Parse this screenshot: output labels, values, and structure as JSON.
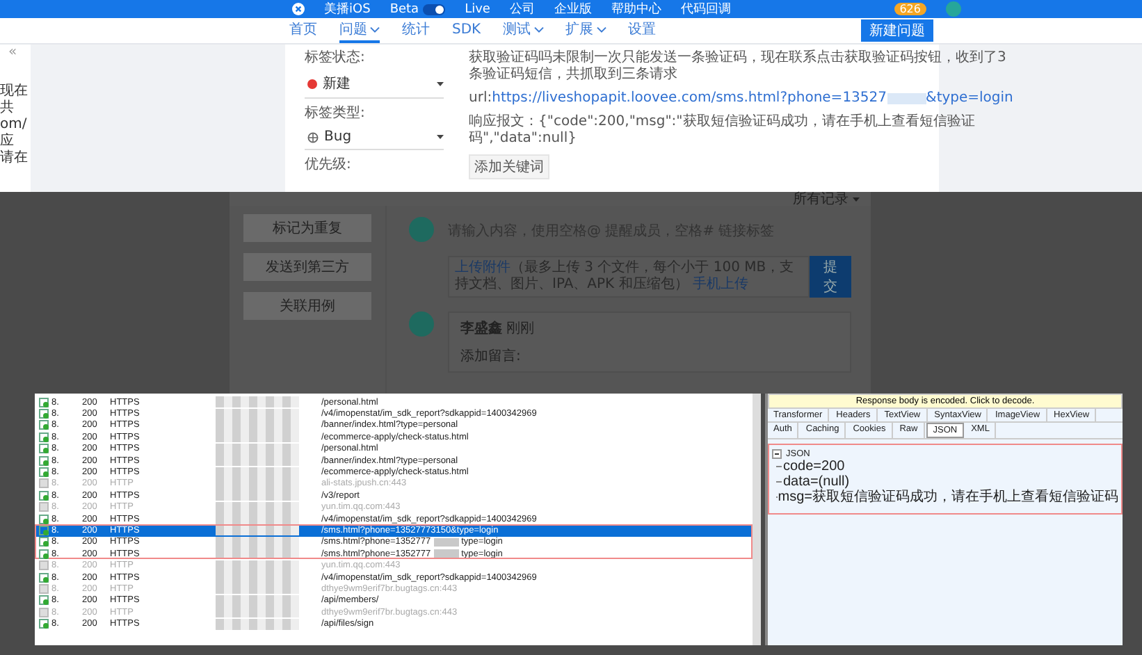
{
  "top_bar": {
    "items": [
      {
        "kind": "project",
        "label": "美播iOS"
      },
      {
        "kind": "toggle",
        "label": "Beta",
        "on": true
      },
      {
        "kind": "text",
        "label": "Live"
      },
      {
        "kind": "text",
        "label": "公司"
      },
      {
        "kind": "text",
        "label": "企业版"
      },
      {
        "kind": "text",
        "label": "帮助中心"
      },
      {
        "kind": "text",
        "label": "代码回调"
      }
    ],
    "badge": "626"
  },
  "nav": {
    "items": [
      {
        "label": "首页",
        "selected": false,
        "dropdown": false
      },
      {
        "label": "问题",
        "selected": true,
        "dropdown": true
      },
      {
        "label": "统计",
        "selected": false,
        "dropdown": false
      },
      {
        "label": "SDK",
        "selected": false,
        "dropdown": false
      },
      {
        "label": "测试",
        "selected": false,
        "dropdown": true
      },
      {
        "label": "扩展",
        "selected": false,
        "dropdown": true
      },
      {
        "label": "设置",
        "selected": false,
        "dropdown": false
      }
    ],
    "new_button": "新建问题"
  },
  "side_strip": {
    "collapse": "«",
    "fragments": [
      "现在",
      "共",
      "om/",
      "应",
      "请在"
    ]
  },
  "issue": {
    "fields": [
      {
        "label": "标签状态:",
        "value": "新建",
        "kind": "status",
        "color": "#e53935"
      },
      {
        "label": "标签类型:",
        "value": "Bug",
        "kind": "type"
      },
      {
        "label": "优先级:",
        "kind": "label"
      }
    ],
    "description": "获取验证码吗未限制一次只能发送一条验证码，现在联系点击获取验证码按钮，收到了3条验证码短信，共抓取到三条请求",
    "url_label": "url:",
    "url": "https://liveshopapit.loovee.com/sms.html?phone=13527",
    "url_end": "&type=login",
    "response": "响应报文：{\"code\":200,\"msg\":\"获取短信验证码成功，请在手机上查看短信验证码\",\"data\":null}",
    "keyword_button": "添加关键词"
  },
  "actions": [
    "标记为重复",
    "发送到第三方",
    "关联用例"
  ],
  "records_filter": "所有记录",
  "comment": {
    "placeholder": "请输入内容，使用空格@ 提醒成员，空格# 链接标签",
    "upload_link": "上传附件",
    "upload_note": "（最多上传 3 个文件，每个小于 100 MB，支持文档、图片、IPA、APK 和压缩包）",
    "mobile_link": "手机上传",
    "submit": "提交"
  },
  "entry": {
    "author": "李盛鑫",
    "time": "刚刚",
    "note": "添加留言:"
  },
  "sessions": [
    {
      "kind": "https",
      "result": "8.",
      "code": "200",
      "protocol": "HTTPS",
      "url": "/personal.html",
      "selected": false
    },
    {
      "kind": "https",
      "result": "8.",
      "code": "200",
      "protocol": "HTTPS",
      "url": "/v4/imopenstat/im_sdk_report?sdkappid=1400342969",
      "selected": false
    },
    {
      "kind": "https",
      "result": "8.",
      "code": "200",
      "protocol": "HTTPS",
      "url": "/banner/index.html?type=personal",
      "selected": false
    },
    {
      "kind": "https",
      "result": "8.",
      "code": "200",
      "protocol": "HTTPS",
      "url": "/ecommerce-apply/check-status.html",
      "selected": false
    },
    {
      "kind": "https",
      "result": "8.",
      "code": "200",
      "protocol": "HTTPS",
      "url": "/personal.html",
      "selected": false
    },
    {
      "kind": "https",
      "result": "8.",
      "code": "200",
      "protocol": "HTTPS",
      "url": "/banner/index.html?type=personal",
      "selected": false
    },
    {
      "kind": "https",
      "result": "8.",
      "code": "200",
      "protocol": "HTTPS",
      "url": "/ecommerce-apply/check-status.html",
      "selected": false
    },
    {
      "kind": "tunnel",
      "result": "8.",
      "code": "200",
      "protocol": "HTTP",
      "url": "ali-stats.jpush.cn:443",
      "selected": false
    },
    {
      "kind": "https",
      "result": "8.",
      "code": "200",
      "protocol": "HTTPS",
      "url": "/v3/report",
      "selected": false
    },
    {
      "kind": "tunnel",
      "result": "8.",
      "code": "200",
      "protocol": "HTTP",
      "url": "yun.tim.qq.com:443",
      "selected": false
    },
    {
      "kind": "https",
      "result": "8.",
      "code": "200",
      "protocol": "HTTPS",
      "url": "/v4/imopenstat/im_sdk_report?sdkappid=1400342969",
      "selected": false
    },
    {
      "kind": "https",
      "result": "8.",
      "code": "200",
      "protocol": "HTTPS",
      "url": "/sms.html?phone=13527773150&type=login",
      "selected": true
    },
    {
      "kind": "https",
      "result": "8.",
      "code": "200",
      "protocol": "HTTPS",
      "url": "/sms.html?phone=1352777",
      "url_end": "type=login",
      "selected": false
    },
    {
      "kind": "https",
      "result": "8.",
      "code": "200",
      "protocol": "HTTPS",
      "url": "/sms.html?phone=1352777",
      "url_end": "type=login",
      "selected": false
    },
    {
      "kind": "tunnel",
      "result": "8.",
      "code": "200",
      "protocol": "HTTP",
      "url": "yun.tim.qq.com:443",
      "selected": false
    },
    {
      "kind": "https",
      "result": "8.",
      "code": "200",
      "protocol": "HTTPS",
      "url": "/v4/imopenstat/im_sdk_report?sdkappid=1400342969",
      "selected": false
    },
    {
      "kind": "tunnel",
      "result": "8.",
      "code": "200",
      "protocol": "HTTP",
      "url": "dthye9wm9erif7br.bugtags.cn:443",
      "selected": false
    },
    {
      "kind": "https",
      "result": "8.",
      "code": "200",
      "protocol": "HTTPS",
      "url": "/api/members/",
      "selected": false
    },
    {
      "kind": "tunnel",
      "result": "8.",
      "code": "200",
      "protocol": "HTTP",
      "url": "dthye9wm9erif7br.bugtags.cn:443",
      "selected": false
    },
    {
      "kind": "https",
      "result": "8.",
      "code": "200",
      "protocol": "HTTPS",
      "url": "/api/files/sign",
      "selected": false
    }
  ],
  "inspector": {
    "banner": "Response body is encoded. Click to decode.",
    "tabs_top": [
      {
        "label": "Transformer",
        "selected": false
      },
      {
        "label": "Headers",
        "selected": false
      },
      {
        "label": "TextView",
        "selected": false
      },
      {
        "label": "SyntaxView",
        "selected": false
      },
      {
        "label": "ImageView",
        "selected": false
      },
      {
        "label": "HexView",
        "selected": false
      }
    ],
    "tabs_bottom": [
      {
        "label": "Auth",
        "selected": false
      },
      {
        "label": "Caching",
        "selected": false
      },
      {
        "label": "Cookies",
        "selected": false
      },
      {
        "label": "Raw",
        "selected": false
      },
      {
        "label": "JSON",
        "selected": true
      },
      {
        "label": "XML",
        "selected": false
      }
    ],
    "tree": {
      "label": "JSON",
      "expanded": true,
      "children": [
        {
          "label": "code=200"
        },
        {
          "label": "data=(null)"
        },
        {
          "label": "msg=获取短信验证码成功，请在手机上查看短信验证码"
        }
      ]
    }
  }
}
